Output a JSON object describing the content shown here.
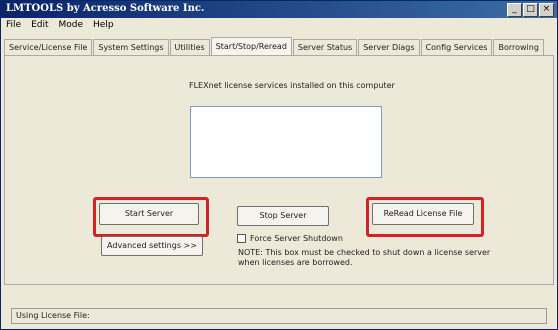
{
  "window": {
    "title": "LMTOOLS by Acresso Software Inc.",
    "min": "_",
    "max": "□",
    "close": "×"
  },
  "menu": [
    "File",
    "Edit",
    "Mode",
    "Help"
  ],
  "tabs": [
    "Service/License File",
    "System Settings",
    "Utilities",
    "Start/Stop/Reread",
    "Server Status",
    "Server Diags",
    "Config Services",
    "Borrowing"
  ],
  "panel": {
    "caption": "FLEXnet license services installed on this computer",
    "start_btn": "Start Server",
    "stop_btn": "Stop Server",
    "reread_btn": "ReRead License File",
    "advanced_btn": "Advanced settings >>",
    "force_label": "Force Server Shutdown",
    "note": "NOTE:  This box must be checked to shut down a license server when licenses are borrowed."
  },
  "status": {
    "label": "Using License File:"
  },
  "colors": {
    "highlight": "#d52128",
    "title_bar": "#0a246a"
  }
}
